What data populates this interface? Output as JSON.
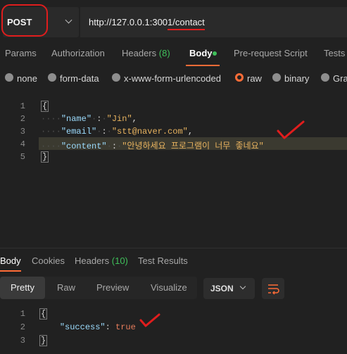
{
  "request": {
    "method": "POST",
    "url": "http://127.0.0.1:3001/contact"
  },
  "request_tabs": [
    {
      "label": "Params"
    },
    {
      "label": "Authorization"
    },
    {
      "label": "Headers",
      "count": "(8)"
    },
    {
      "label": "Body"
    },
    {
      "label": "Pre-request Script"
    },
    {
      "label": "Tests"
    }
  ],
  "body_types": [
    "none",
    "form-data",
    "x-www-form-urlencoded",
    "raw",
    "binary",
    "Gra"
  ],
  "body_types_selected": "raw",
  "request_body": {
    "line_numbers": [
      "1",
      "2",
      "3",
      "4",
      "5"
    ],
    "open_brace": "{",
    "close_brace": "}",
    "fields": [
      {
        "key": "\"name\"",
        "value": "\"Jin\"",
        "trail": ","
      },
      {
        "key": "\"email\"",
        "value": "\"stt@naver.com\"",
        "trail": ","
      },
      {
        "key": "\"content\"",
        "value": "\"안녕하세요 프로그램이 너무 좋네요\"",
        "trail": ""
      }
    ]
  },
  "response_tabs": [
    {
      "label": "Body"
    },
    {
      "label": "Cookies"
    },
    {
      "label": "Headers",
      "count": "(10)"
    },
    {
      "label": "Test Results"
    }
  ],
  "view_modes": [
    "Pretty",
    "Raw",
    "Preview",
    "Visualize"
  ],
  "view_modes_selected": "Pretty",
  "format": "JSON",
  "response_body": {
    "line_numbers": [
      "1",
      "2",
      "3"
    ],
    "open_brace": "{",
    "close_brace": "}",
    "key": "\"success\"",
    "colon": ":",
    "value": "true"
  },
  "colors": {
    "background": "#212121",
    "accent": "#ff6c37",
    "green": "#3fbf5a",
    "annotation_red": "#e01d1d",
    "key": "#9cdcfe",
    "string": "#e8b35f"
  }
}
